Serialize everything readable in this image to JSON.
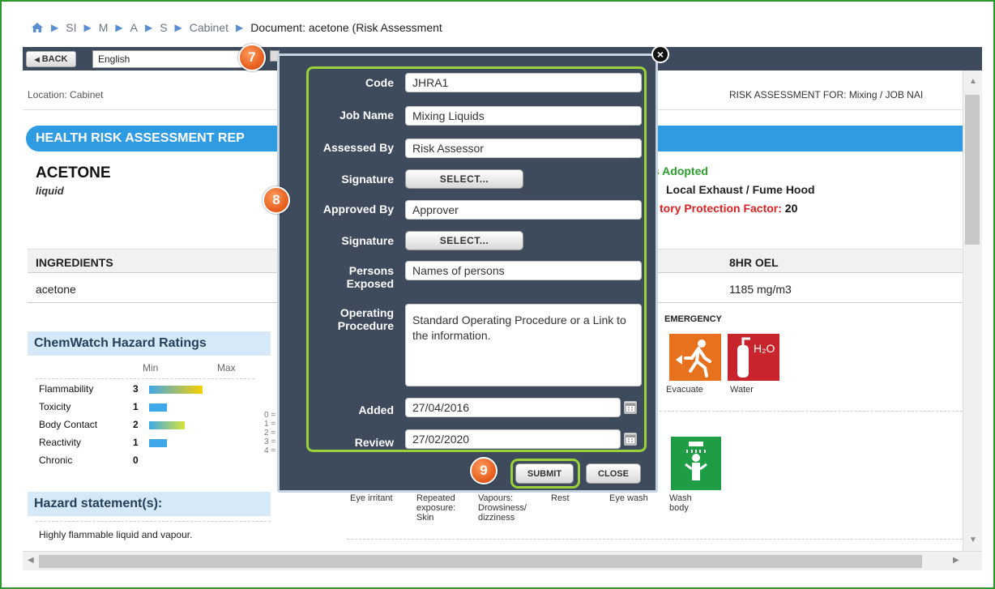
{
  "breadcrumb": {
    "items": [
      "SI",
      "M",
      "A",
      "S",
      "Cabinet"
    ],
    "current": "Document: acetone (Risk Assessment"
  },
  "toolbar": {
    "back_label": "BACK",
    "language": "English"
  },
  "page": {
    "location": "Location: Cabinet",
    "risk_for": "RISK ASSESSMENT FOR: Mixing / JOB NAI",
    "report_title": "HEALTH RISK ASSESSMENT REP",
    "chemical_name": "ACETONE",
    "chemical_form": "liquid",
    "controls": {
      "adopted": "s Adopted",
      "method": "Local Exhaust / Fume Hood",
      "protection_label": "tory Protection Factor:",
      "protection_value": "20"
    },
    "ingredients_header": "INGREDIENTS",
    "oel_header": "8HR OEL",
    "ingredient": "acetone",
    "oel_value": "1185 mg/m3",
    "ratings_title": "ChemWatch Hazard Ratings",
    "ratings_min": "Min",
    "ratings_max": "Max",
    "ratings": [
      {
        "label": "Flammability",
        "value": 3
      },
      {
        "label": "Toxicity",
        "value": 1
      },
      {
        "label": "Body Contact",
        "value": 2
      },
      {
        "label": "Reactivity",
        "value": 1
      },
      {
        "label": "Chronic",
        "value": 0
      }
    ],
    "scale_labels": [
      "0 =",
      "1 =",
      "2 =",
      "3 =",
      "4 ="
    ],
    "emergency_title": "EMERGENCY",
    "evacuate_label": "Evacuate",
    "water_label": "Water",
    "water_symbol": "H₂O",
    "pictogram_captions": [
      "Eye irritant",
      "Repeated exposure: Skin",
      "Vapours: Drowsiness/ dizziness",
      "Rest",
      "Eye wash",
      "Wash body"
    ],
    "hazard_title": "Hazard statement(s):",
    "hazard_text": "Highly flammable liquid and vapour."
  },
  "modal": {
    "code_label": "Code",
    "code_value": "JHRA1",
    "job_label": "Job Name",
    "job_value": "Mixing Liquids",
    "assessed_label": "Assessed By",
    "assessed_value": "Risk Assessor",
    "signature_label": "Signature",
    "select_label": "SELECT...",
    "approved_label": "Approved By",
    "approved_value": "Approver",
    "persons_label": "Persons Exposed",
    "persons_value": "Names of persons",
    "procedure_label": "Operating Procedure",
    "procedure_value": "Standard Operating Procedure or a Link to the information.",
    "added_label": "Added",
    "added_value": "27/04/2016",
    "review_label": "Review",
    "review_value": "27/02/2020",
    "submit_label": "SUBMIT",
    "close_label": "CLOSE",
    "close_x": "×"
  },
  "steps": {
    "seven": "7",
    "eight": "8",
    "nine": "9"
  },
  "colors": {
    "accent": "#2f9be3",
    "highlight": "#9ad038",
    "step": "#e45a1a",
    "toolbar": "#3d4b5d"
  }
}
